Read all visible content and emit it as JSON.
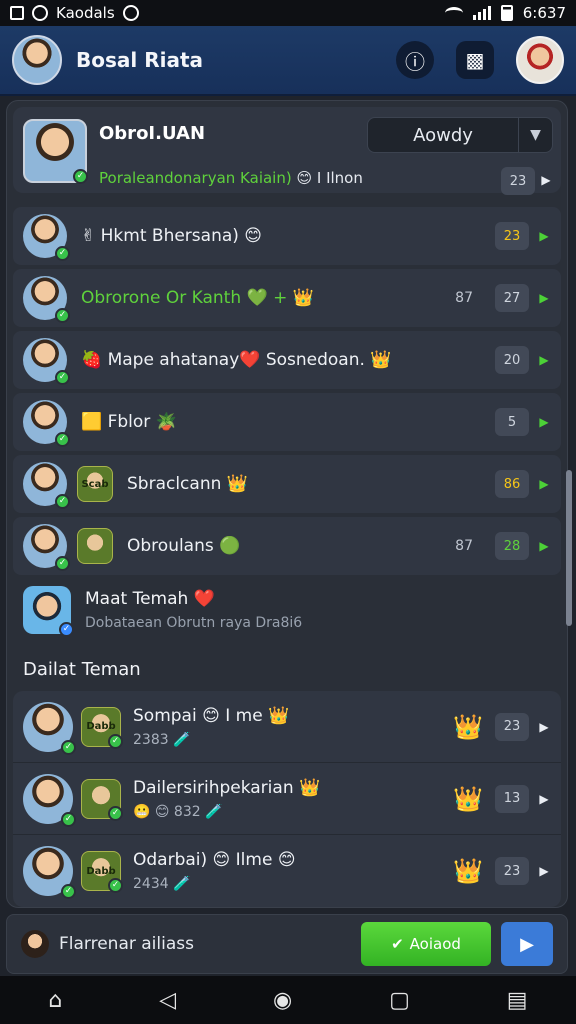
{
  "status_bar": {
    "app_name": "Kaodals",
    "time": "6:637"
  },
  "app_bar": {
    "title": "Bosal Riata"
  },
  "group": {
    "name": "ObroI.UAN",
    "subtitle_green": "Poraleandonaryan Kaiain)",
    "subtitle_rest": " 😊 I Ilnon",
    "badge": "23",
    "filter_value": "Aowdy"
  },
  "list_rows": [
    {
      "label": "✌ Hkmt Bhersana) 😊",
      "label_color": "#eef1f5",
      "count": "",
      "badge": "23",
      "badge_style": "yellow",
      "chevron": "green",
      "avatar_mini": false
    },
    {
      "label": "Obrorone Or Kanth 💚 + 👑",
      "label_color": "#5fd23c",
      "count": "87",
      "badge": "27",
      "badge_style": "",
      "chevron": "green",
      "avatar_mini": false
    },
    {
      "label": "🍓 Mape ahatanay❤️ Sosnedoan. 👑",
      "label_color": "#eef1f5",
      "count": "",
      "badge": "20",
      "badge_style": "",
      "chevron": "green",
      "avatar_mini": false
    },
    {
      "label": "🟨 Fblor 🪴",
      "label_color": "#eef1f5",
      "count": "",
      "badge": "5",
      "badge_style": "",
      "chevron": "green",
      "avatar_mini": false
    },
    {
      "label": "Sbraclcann 👑",
      "label_color": "#eef1f5",
      "count": "",
      "badge": "86",
      "badge_style": "yellow",
      "chevron": "green",
      "avatar_mini": true,
      "mini_text": "Scab"
    },
    {
      "label": "Obroulans 🟢",
      "label_color": "#eef1f5",
      "count": "87",
      "badge": "28",
      "badge_style": "green",
      "chevron": "green",
      "avatar_mini": true,
      "mini_text": ""
    }
  ],
  "friend_preview": {
    "title": "Maat Temah ❤️",
    "subtitle": "Dobataean Obrutn raya Dra8i6"
  },
  "section_title": "Dailat Teman",
  "friends": [
    {
      "name": "Sompai 😊 I me 👑",
      "sub": "2383 🧪",
      "mini_text": "Dabb",
      "badge": "23"
    },
    {
      "name": "Dailersirihpekarian 👑",
      "sub": "😬 😊 832 🧪",
      "mini_text": "",
      "badge": "13"
    },
    {
      "name": "Odarbai) 😊 Ilme 😊",
      "sub": "2434 🧪",
      "mini_text": "Dabb",
      "badge": "23"
    }
  ],
  "bottom_bar": {
    "input_text": "Flarrenar ailiass",
    "primary_label": "Aoiaod"
  },
  "colors": {
    "accent_green": "#38c24a",
    "header_blue": "#1d3a66",
    "button_blue": "#3b7bd8"
  },
  "icons": {
    "status_left": [
      "gallery-icon",
      "app-icon",
      "notification-icon"
    ],
    "status_right": [
      "wifi-icon",
      "signal-icon",
      "battery-icon"
    ],
    "app_bar": [
      "info-icon",
      "game-icon"
    ],
    "nav": [
      "home-icon",
      "back-icon",
      "camera-icon",
      "recents-icon",
      "menu-icon"
    ]
  }
}
